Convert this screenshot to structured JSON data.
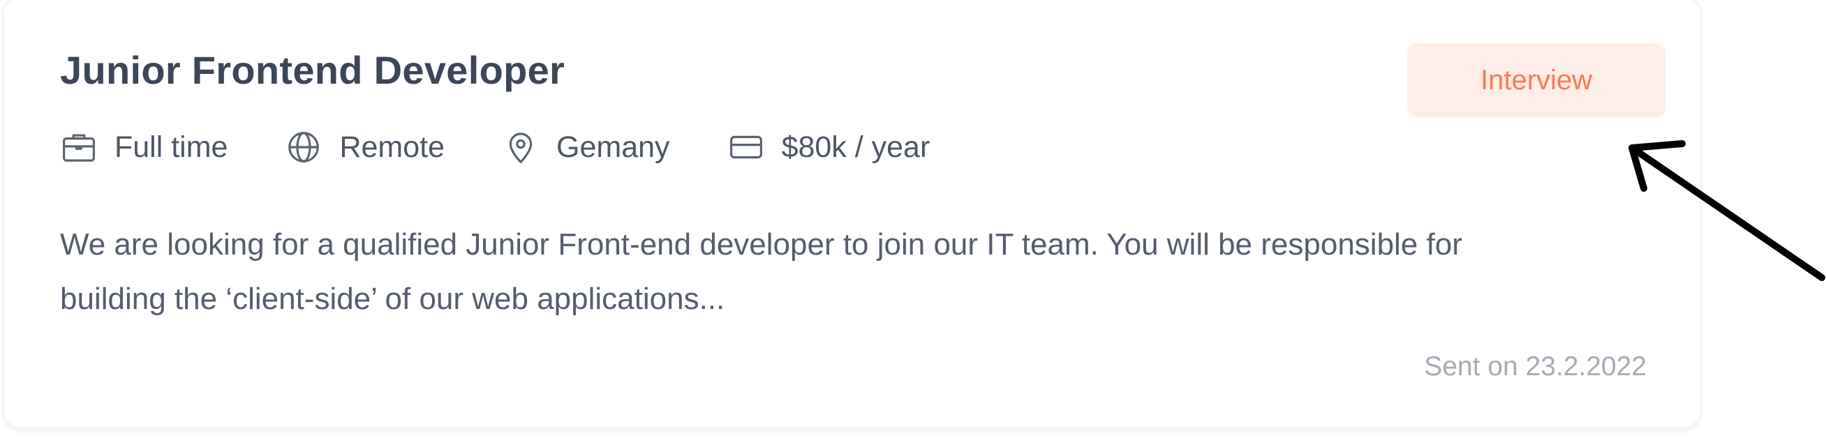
{
  "job": {
    "title": "Junior Frontend Developer",
    "status": "Interview",
    "meta": [
      {
        "icon": "briefcase-icon",
        "label": "Full time"
      },
      {
        "icon": "globe-icon",
        "label": "Remote"
      },
      {
        "icon": "location-pin-icon",
        "label": "Gemany"
      },
      {
        "icon": "credit-card-icon",
        "label": "$80k / year"
      }
    ],
    "description": "We are looking for a qualified Junior Front-end developer to join our IT team. You will be responsible for building the ‘client-side’ of our web applications...",
    "sent_date": "Sent on 23.2.2022"
  },
  "colors": {
    "title": "#3c4658",
    "text": "#4d5566",
    "status_bg": "#ffede7",
    "status_text": "#fb7a56",
    "muted": "#a6abb5",
    "arrow": "#000000"
  }
}
